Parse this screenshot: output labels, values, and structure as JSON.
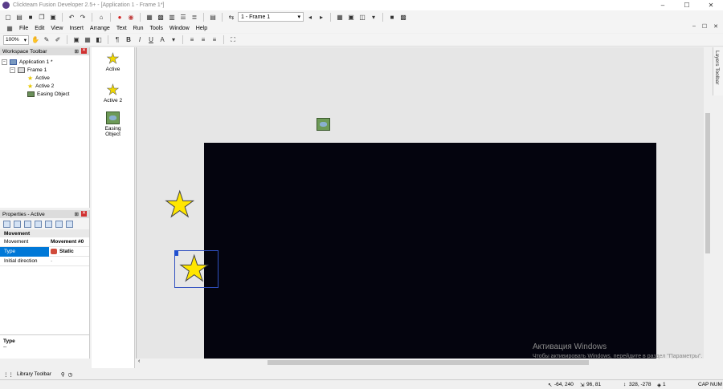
{
  "window": {
    "title": "Clickteam Fusion Developer 2.5+ - [Application 1 - Frame 1*]",
    "controls": [
      "–",
      "☐",
      "✕"
    ]
  },
  "toolbar1": {
    "frame_select": "1 - Frame 1"
  },
  "menu": {
    "items": [
      "File",
      "Edit",
      "View",
      "Insert",
      "Arrange",
      "Text",
      "Run",
      "Tools",
      "Window",
      "Help"
    ],
    "mdi_controls": [
      "–",
      "☐",
      "✕"
    ]
  },
  "toolbar2": {
    "zoom": "100%",
    "bold": "B",
    "italic": "I",
    "underline": "U"
  },
  "workspace": {
    "title": "Workspace Toolbar",
    "tree": [
      {
        "label": "Application 1 *"
      },
      {
        "label": "Frame 1"
      },
      {
        "label": "Active"
      },
      {
        "label": "Active 2"
      },
      {
        "label": "Easing Object"
      }
    ]
  },
  "properties": {
    "title": "Properties - Active",
    "section": "Movement",
    "rows": [
      {
        "key": "Movement",
        "value": "Movement #0"
      },
      {
        "key": "Type",
        "value": "Static"
      },
      {
        "key": "Initial direction",
        "value": "·"
      }
    ],
    "description_title": "Type",
    "description_text": "--"
  },
  "library": {
    "title": "Library Toolbar"
  },
  "object_panel": {
    "items": [
      {
        "label": "Active"
      },
      {
        "label": "Active 2"
      },
      {
        "label": "Easing Object"
      }
    ]
  },
  "layers_toolbar": "Layers Toolbar",
  "watermark": {
    "line1": "Активация Windows",
    "line2": "Чтобы активировать Windows, перейдите в раздел \"Параметры\"."
  },
  "status": {
    "coords_mouse": "-64, 240",
    "size": "96, 81",
    "coords_frame": "328, -278",
    "layer": "1",
    "keys": "CAP NUM"
  },
  "colors": {
    "frame_background": "#04040e",
    "selection": "#3050c0",
    "star": "#ffe600"
  }
}
